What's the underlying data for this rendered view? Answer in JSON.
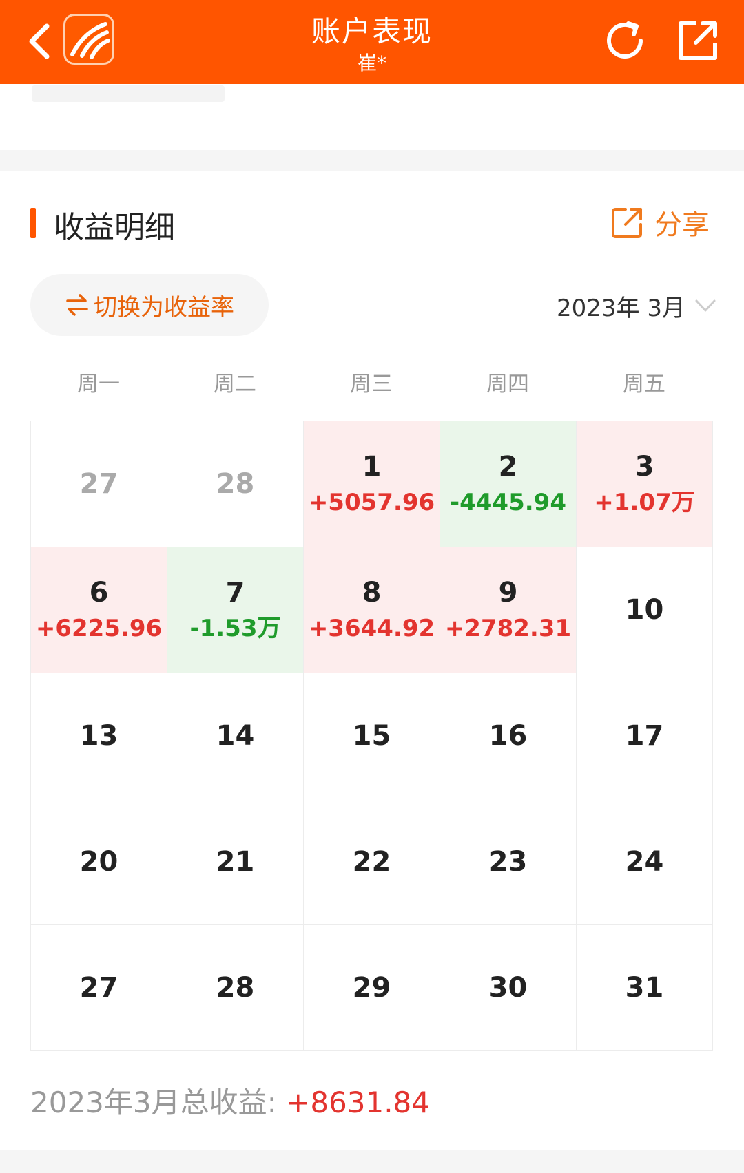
{
  "header": {
    "title": "账户表现",
    "subtitle": "崔*",
    "icons": {
      "back": "chevron-left-icon",
      "logo": "app-logo",
      "refresh": "refresh-icon",
      "external": "external-link-icon"
    }
  },
  "section": {
    "title": "收益明细",
    "share_label": "分享"
  },
  "controls": {
    "toggle_label": "切换为收益率",
    "month_label": "2023年 3月"
  },
  "weekdays": [
    "周一",
    "周二",
    "周三",
    "周四",
    "周五"
  ],
  "calendar": [
    {
      "day": "27",
      "pnl": "",
      "state": "muted"
    },
    {
      "day": "28",
      "pnl": "",
      "state": "muted"
    },
    {
      "day": "1",
      "pnl": "+5057.96",
      "state": "up"
    },
    {
      "day": "2",
      "pnl": "-4445.94",
      "state": "down"
    },
    {
      "day": "3",
      "pnl": "+1.07万",
      "state": "up"
    },
    {
      "day": "6",
      "pnl": "+6225.96",
      "state": "up"
    },
    {
      "day": "7",
      "pnl": "-1.53万",
      "state": "down"
    },
    {
      "day": "8",
      "pnl": "+3644.92",
      "state": "up"
    },
    {
      "day": "9",
      "pnl": "+2782.31",
      "state": "up"
    },
    {
      "day": "10",
      "pnl": "",
      "state": "none"
    },
    {
      "day": "13",
      "pnl": "",
      "state": "none"
    },
    {
      "day": "14",
      "pnl": "",
      "state": "none"
    },
    {
      "day": "15",
      "pnl": "",
      "state": "none"
    },
    {
      "day": "16",
      "pnl": "",
      "state": "none"
    },
    {
      "day": "17",
      "pnl": "",
      "state": "none"
    },
    {
      "day": "20",
      "pnl": "",
      "state": "none"
    },
    {
      "day": "21",
      "pnl": "",
      "state": "none"
    },
    {
      "day": "22",
      "pnl": "",
      "state": "none"
    },
    {
      "day": "23",
      "pnl": "",
      "state": "none"
    },
    {
      "day": "24",
      "pnl": "",
      "state": "none"
    },
    {
      "day": "27",
      "pnl": "",
      "state": "none"
    },
    {
      "day": "28",
      "pnl": "",
      "state": "none"
    },
    {
      "day": "29",
      "pnl": "",
      "state": "none"
    },
    {
      "day": "30",
      "pnl": "",
      "state": "none"
    },
    {
      "day": "31",
      "pnl": "",
      "state": "none"
    }
  ],
  "summary": {
    "label": "2023年3月总收益:",
    "value": "+8631.84"
  },
  "colors": {
    "brand": "#ff5500",
    "up": "#e3342f",
    "down": "#1f9b2b",
    "up_bg": "#fdeded",
    "down_bg": "#eaf6ea"
  }
}
